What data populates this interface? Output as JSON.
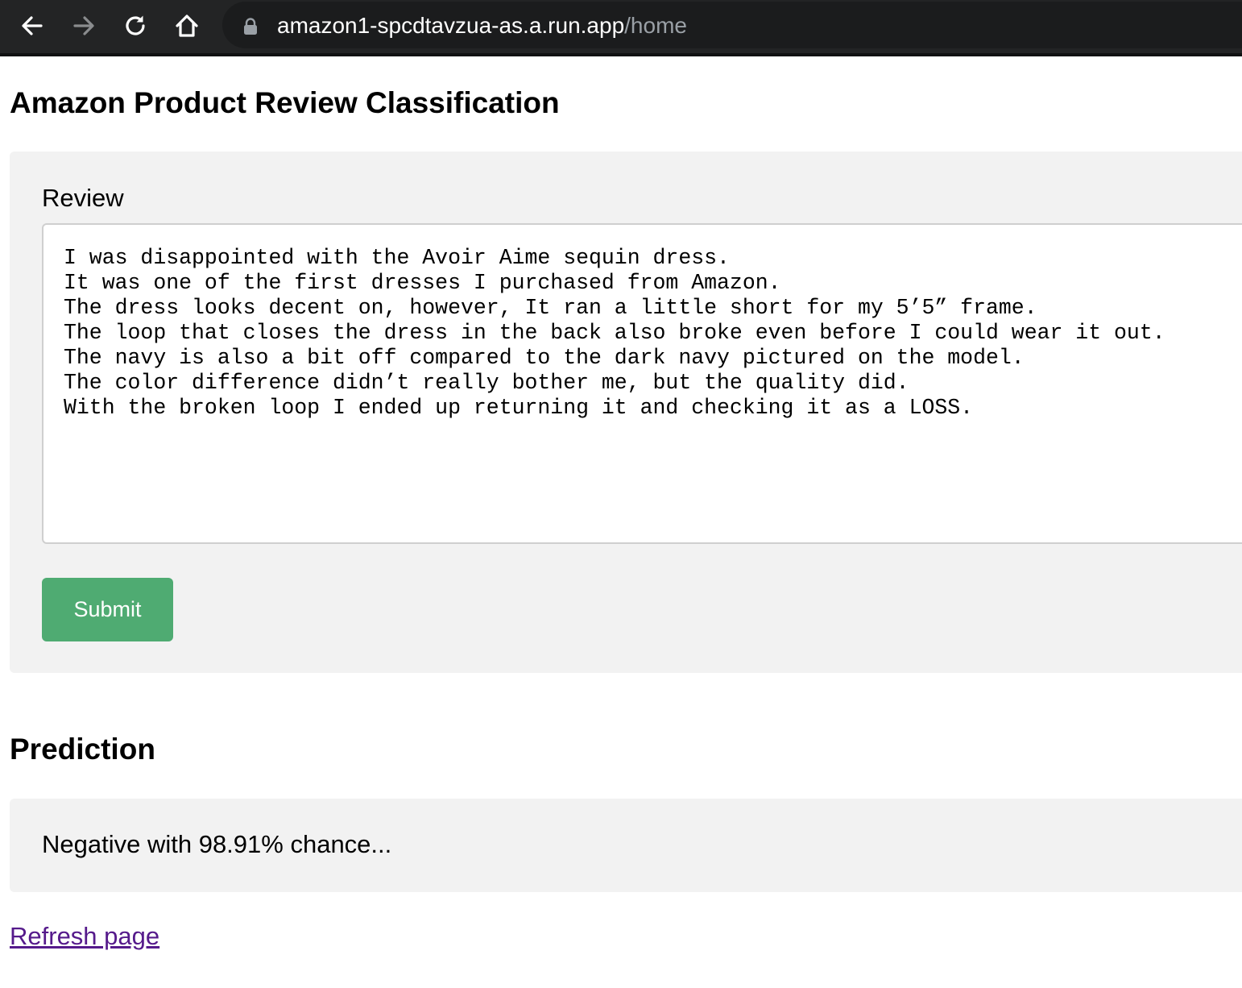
{
  "browser": {
    "url_host": "amazon1-spcdtavzua-as.a.run.app",
    "url_path": "/home",
    "icons": {
      "back": "arrow-left-icon",
      "forward": "arrow-right-icon",
      "reload": "reload-icon",
      "home": "home-icon",
      "lock": "lock-icon"
    }
  },
  "page": {
    "title": "Amazon Product Review Classification"
  },
  "form": {
    "review_label": "Review",
    "review_value": "I was disappointed with the Avoir Aime sequin dress.\nIt was one of the first dresses I purchased from Amazon.\nThe dress looks decent on, however, It ran a little short for my 5’5” frame.\nThe loop that closes the dress in the back also broke even before I could wear it out.\nThe navy is also a bit off compared to the dark navy pictured on the model.\nThe color difference didn’t really bother me, but the quality did.\nWith the broken loop I ended up returning it and checking it as a LOSS.",
    "submit_label": "Submit"
  },
  "prediction": {
    "title": "Prediction",
    "result": "Negative with 98.91% chance..."
  },
  "links": {
    "refresh_label": "Refresh page"
  },
  "colors": {
    "submit_bg": "#4fab72",
    "panel_bg": "#f2f2f2",
    "link_visited": "#551a8b"
  }
}
